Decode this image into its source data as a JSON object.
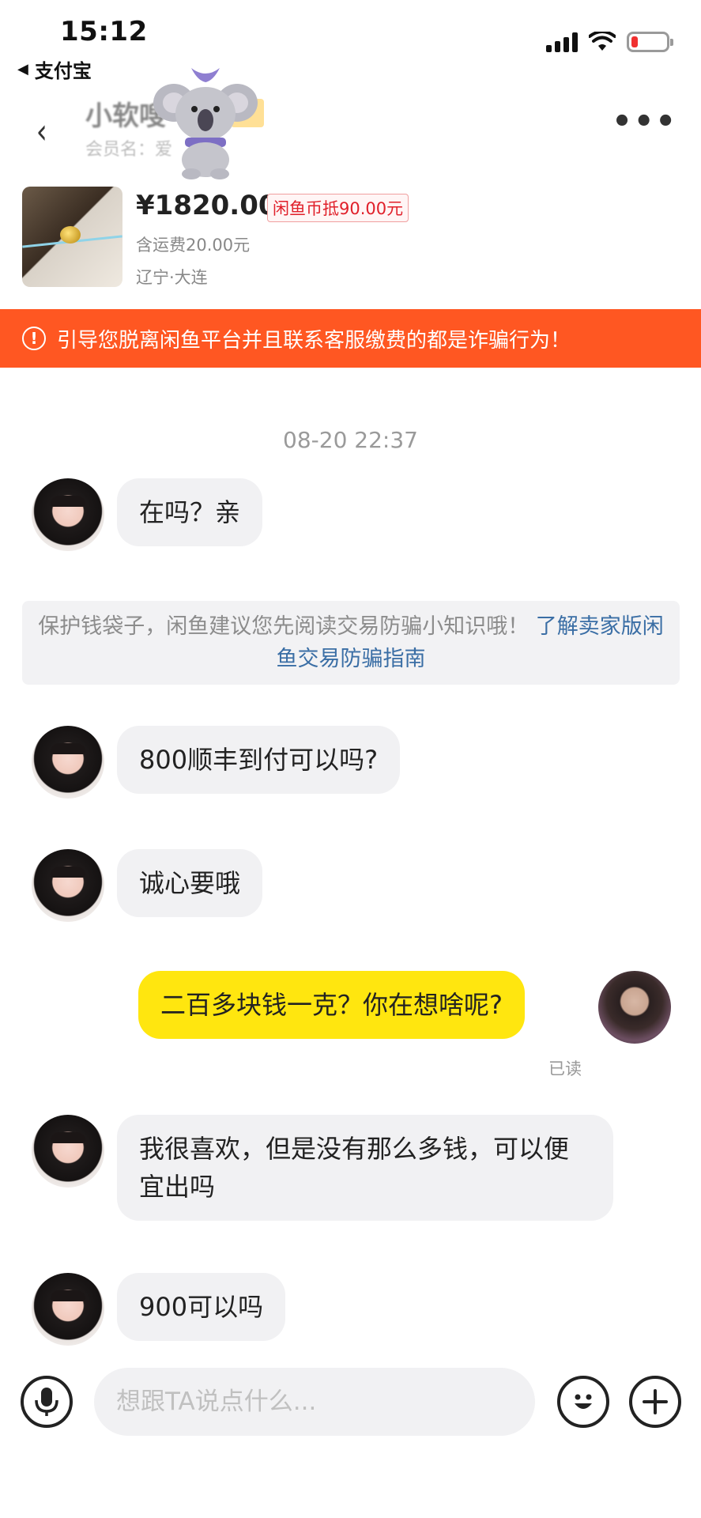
{
  "status_bar": {
    "time": "15:12",
    "back_app": "支付宝"
  },
  "header": {
    "seller_name": "小软嗖",
    "member_info": "会员名：爱",
    "more_label": "•••"
  },
  "product": {
    "price": "¥1820.00",
    "coin_tag": "闲鱼币抵90.00元",
    "shipping": "含运费20.00元",
    "location": "辽宁·大连"
  },
  "warning": {
    "icon": "!",
    "text": "引导您脱离闲鱼平台并且联系客服缴费的都是诈骗行为！"
  },
  "chat": {
    "timestamp": "08-20 22:37",
    "messages": [
      {
        "from": "seller",
        "text": "在吗？亲"
      },
      {
        "from": "system",
        "text": "保护钱袋子，闲鱼建议您先阅读交易防骗小知识哦！",
        "link": "了解卖家版闲鱼交易防骗指南"
      },
      {
        "from": "seller",
        "text": "800顺丰到付可以吗?"
      },
      {
        "from": "seller",
        "text": "诚心要哦"
      },
      {
        "from": "me",
        "text": "二百多块钱一克？你在想啥呢?",
        "status": "已读"
      },
      {
        "from": "seller",
        "text": "我很喜欢，但是没有那么多钱，可以便宜出吗"
      },
      {
        "from": "seller",
        "text": "900可以吗"
      }
    ]
  },
  "input_bar": {
    "placeholder": "想跟TA说点什么...",
    "voice_icon": "microphone-icon",
    "emoji_icon": "emoji-icon",
    "plus_icon": "plus-icon"
  },
  "colors": {
    "warning_bg": "#ff5722",
    "my_bubble": "#ffe60f",
    "other_bubble": "#f1f1f3",
    "link": "#3a6ea5"
  }
}
